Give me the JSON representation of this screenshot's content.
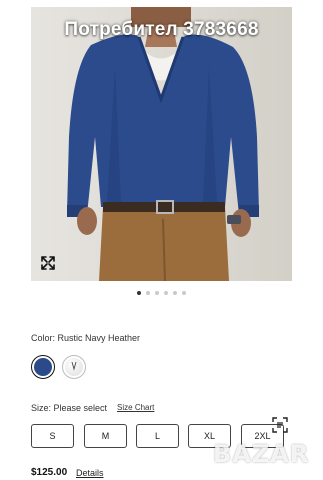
{
  "product": {
    "overlay_title": "Потребител 3783668",
    "gallery_dot_count": 6,
    "gallery_active_index": 1
  },
  "color": {
    "label": "Color: Rustic Navy Heather",
    "swatches": [
      {
        "name": "Rustic Navy Heather",
        "hex": "#2a4a8a",
        "selected": true
      },
      {
        "name": "Light Gray",
        "hex": "#e9e9e9",
        "selected": false
      }
    ]
  },
  "size": {
    "label": "Size: Please select",
    "chart_link": "Size Chart",
    "options": [
      "S",
      "M",
      "L",
      "XL",
      "2XL"
    ]
  },
  "price": {
    "amount": "$125.00",
    "details_link": "Details"
  },
  "watermark": {
    "text": "BAZAR"
  },
  "icons": {
    "expand": "expand-arrows-icon",
    "lens": "visual-search-icon"
  }
}
